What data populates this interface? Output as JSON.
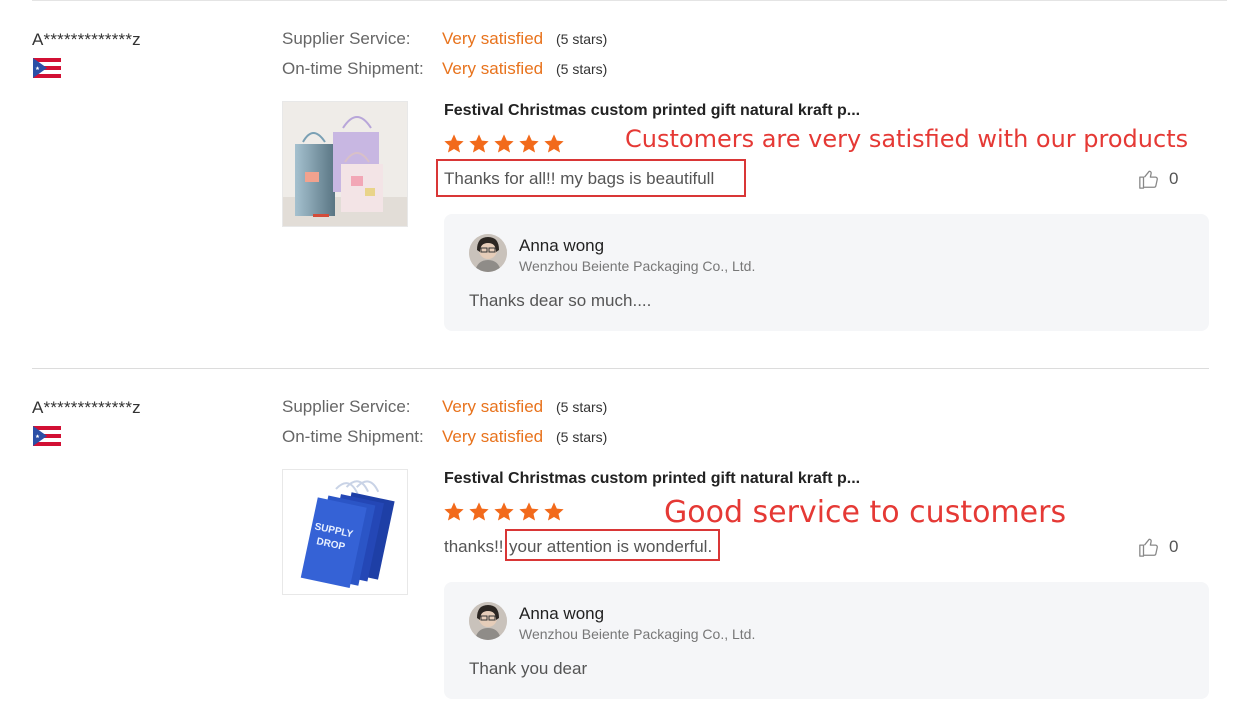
{
  "reviews": [
    {
      "user": "A*************z",
      "flag_icon": "puerto-rico-flag-icon",
      "ratings": [
        {
          "label": "Supplier Service:",
          "value": "Very satisfied",
          "stars": "(5 stars)"
        },
        {
          "label": "On-time Shipment:",
          "value": "Very satisfied",
          "stars": "(5 stars)"
        }
      ],
      "product_title": "Festival Christmas custom printed gift natural kraft p...",
      "star_rating": 5,
      "comment": "Thanks for all!! my bags is beautifull",
      "likes": "0",
      "reply": {
        "name": "Anna wong",
        "company": "Wenzhou Beiente Packaging Co., Ltd.",
        "text": "Thanks dear so much...."
      },
      "annotation": "Customers are very satisfied with our products"
    },
    {
      "user": "A*************z",
      "flag_icon": "puerto-rico-flag-icon",
      "ratings": [
        {
          "label": "Supplier Service:",
          "value": "Very satisfied",
          "stars": "(5 stars)"
        },
        {
          "label": "On-time Shipment:",
          "value": "Very satisfied",
          "stars": "(5 stars)"
        }
      ],
      "product_title": "Festival Christmas custom printed gift natural kraft p...",
      "star_rating": 5,
      "comment_prefix": "thanks!!",
      "comment": "your attention is wonderful.",
      "likes": "0",
      "reply": {
        "name": "Anna wong",
        "company": "Wenzhou Beiente Packaging Co., Ltd.",
        "text": "Thank you dear"
      },
      "annotation": "Good service to customers"
    }
  ],
  "colors": {
    "accent": "#e8731d",
    "star": "#f26a1b",
    "annotation": "#e53935",
    "reply_bg": "#f5f6f8"
  }
}
